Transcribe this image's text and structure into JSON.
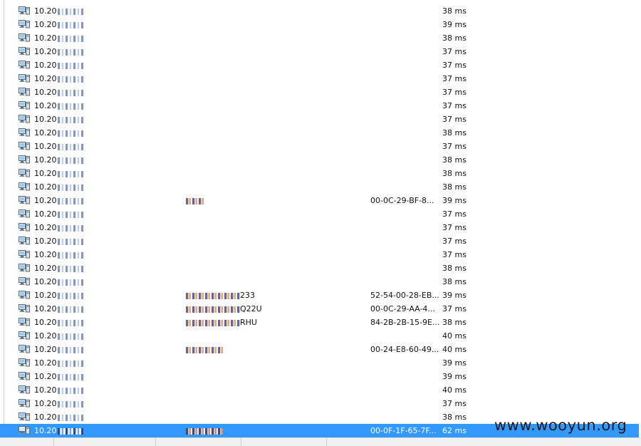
{
  "table": {
    "rows": [
      {
        "ip": "10.20",
        "name": "",
        "mac": "",
        "ms": "38 ms",
        "selected": false
      },
      {
        "ip": "10.20",
        "name": "",
        "mac": "",
        "ms": "39 ms",
        "selected": false
      },
      {
        "ip": "10.20",
        "name": "",
        "mac": "",
        "ms": "38 ms",
        "selected": false
      },
      {
        "ip": "10.20",
        "name": "",
        "mac": "",
        "ms": "37 ms",
        "selected": false
      },
      {
        "ip": "10.20",
        "name": "",
        "mac": "",
        "ms": "37 ms",
        "selected": false
      },
      {
        "ip": "10.20",
        "name": "",
        "mac": "",
        "ms": "37 ms",
        "selected": false
      },
      {
        "ip": "10.20",
        "name": "",
        "mac": "",
        "ms": "37 ms",
        "selected": false
      },
      {
        "ip": "10.20",
        "name": "",
        "mac": "",
        "ms": "37 ms",
        "selected": false
      },
      {
        "ip": "10.20",
        "name": "",
        "mac": "",
        "ms": "37 ms",
        "selected": false
      },
      {
        "ip": "10.20",
        "name": "",
        "mac": "",
        "ms": "38 ms",
        "selected": false
      },
      {
        "ip": "10.20",
        "name": "",
        "mac": "",
        "ms": "37 ms",
        "selected": false
      },
      {
        "ip": "10.20",
        "name": "",
        "mac": "",
        "ms": "38 ms",
        "selected": false
      },
      {
        "ip": "10.20",
        "name": "",
        "mac": "",
        "ms": "38 ms",
        "selected": false
      },
      {
        "ip": "10.20",
        "name": "",
        "mac": "",
        "ms": "38 ms",
        "selected": false
      },
      {
        "ip": "10.20",
        "name": "",
        "mac": "00-0C-29-BF-8...",
        "ms": "39 ms",
        "selected": false,
        "name_masked": true
      },
      {
        "ip": "10.20",
        "name": "",
        "mac": "",
        "ms": "37 ms",
        "selected": false
      },
      {
        "ip": "10.20",
        "name": "",
        "mac": "",
        "ms": "37 ms",
        "selected": false
      },
      {
        "ip": "10.20",
        "name": "",
        "mac": "",
        "ms": "37 ms",
        "selected": false
      },
      {
        "ip": "10.20",
        "name": "",
        "mac": "",
        "ms": "37 ms",
        "selected": false
      },
      {
        "ip": "10.20",
        "name": "",
        "mac": "",
        "ms": "38 ms",
        "selected": false
      },
      {
        "ip": "10.20",
        "name": "",
        "mac": "",
        "ms": "38 ms",
        "selected": false
      },
      {
        "ip": "10.20",
        "name": "233",
        "mac": "52-54-00-28-EB...",
        "ms": "39 ms",
        "selected": false,
        "name_masked": true
      },
      {
        "ip": "10.20",
        "name": "Q22U",
        "mac": "00-0C-29-AA-4...",
        "ms": "37 ms",
        "selected": false,
        "name_masked": true
      },
      {
        "ip": "10.20",
        "name": "RHU",
        "mac": "84-2B-2B-15-9E...",
        "ms": "38 ms",
        "selected": false,
        "name_masked": true
      },
      {
        "ip": "10.20",
        "name": "",
        "mac": "",
        "ms": "40 ms",
        "selected": false
      },
      {
        "ip": "10.20",
        "name": "",
        "mac": "00-24-E8-60-49...",
        "ms": "40 ms",
        "selected": false,
        "name_masked": true
      },
      {
        "ip": "10.20",
        "name": "",
        "mac": "",
        "ms": "39 ms",
        "selected": false
      },
      {
        "ip": "10.20",
        "name": "",
        "mac": "",
        "ms": "39 ms",
        "selected": false
      },
      {
        "ip": "10.20",
        "name": "",
        "mac": "",
        "ms": "40 ms",
        "selected": false
      },
      {
        "ip": "10.20",
        "name": "",
        "mac": "",
        "ms": "37 ms",
        "selected": false
      },
      {
        "ip": "10.20",
        "name": "",
        "mac": "",
        "ms": "38 ms",
        "selected": false
      },
      {
        "ip": "10.20",
        "name": "",
        "mac": "00-0F-1F-65-7F...",
        "ms": "62 ms",
        "selected": true,
        "name_masked": true
      }
    ]
  },
  "icons": {
    "row_icon": "network-computer-icon"
  },
  "colors": {
    "selection": "#3399ff",
    "selection_text": "#ffffff"
  },
  "watermark": {
    "text": "www.wooyun.org"
  }
}
